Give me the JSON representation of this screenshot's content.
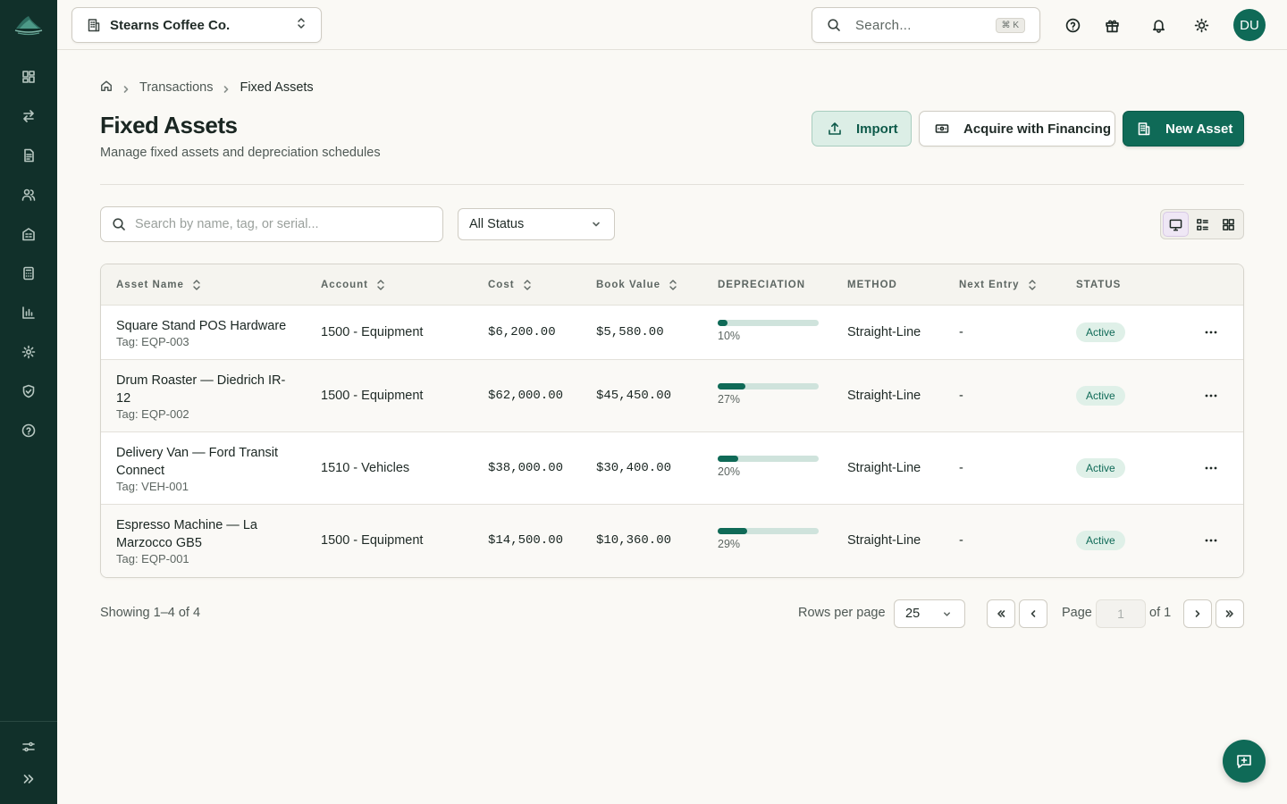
{
  "header": {
    "company": "Stearns Coffee Co.",
    "search_placeholder": "Search...",
    "search_shortcut": "⌘ K",
    "avatar_initials": "DU"
  },
  "breadcrumb": {
    "items": [
      "Transactions",
      "Fixed Assets"
    ]
  },
  "page": {
    "title": "Fixed Assets",
    "subtitle": "Manage fixed assets and depreciation schedules"
  },
  "actions": {
    "import": "Import",
    "acquire": "Acquire with Financing",
    "new_asset": "New Asset"
  },
  "filters": {
    "search_placeholder": "Search by name, tag, or serial...",
    "status_value": "All Status"
  },
  "table": {
    "columns": [
      "Asset Name",
      "Account",
      "Cost",
      "Book Value",
      "DEPRECIATION",
      "METHOD",
      "Next Entry",
      "STATUS"
    ],
    "rows": [
      {
        "name": "Square Stand POS Hardware",
        "tag": "Tag: EQP-003",
        "account": "1500 - Equipment",
        "cost": "$6,200.00",
        "book_value": "$5,580.00",
        "depreciation": 10,
        "depreciation_label": "10%",
        "method": "Straight-Line",
        "next_entry": "-",
        "status": "Active"
      },
      {
        "name": "Drum Roaster — Diedrich IR-12",
        "tag": "Tag: EQP-002",
        "account": "1500 - Equipment",
        "cost": "$62,000.00",
        "book_value": "$45,450.00",
        "depreciation": 27,
        "depreciation_label": "27%",
        "method": "Straight-Line",
        "next_entry": "-",
        "status": "Active"
      },
      {
        "name": "Delivery Van — Ford Transit Connect",
        "tag": "Tag: VEH-001",
        "account": "1510 - Vehicles",
        "cost": "$38,000.00",
        "book_value": "$30,400.00",
        "depreciation": 20,
        "depreciation_label": "20%",
        "method": "Straight-Line",
        "next_entry": "-",
        "status": "Active"
      },
      {
        "name": "Espresso Machine — La Marzocco GB5",
        "tag": "Tag: EQP-001",
        "account": "1500 - Equipment",
        "cost": "$14,500.00",
        "book_value": "$10,360.00",
        "depreciation": 29,
        "depreciation_label": "29%",
        "method": "Straight-Line",
        "next_entry": "-",
        "status": "Active"
      }
    ]
  },
  "pagination": {
    "showing": "Showing 1–4 of 4",
    "rows_per_page_label": "Rows per page",
    "rows_per_page": "25",
    "page_label": "Page",
    "page": "1",
    "of_label": "of 1"
  },
  "colors": {
    "brand": "#0f6a57",
    "sidebar": "#11302a",
    "badge_bg": "#dff0e8"
  }
}
